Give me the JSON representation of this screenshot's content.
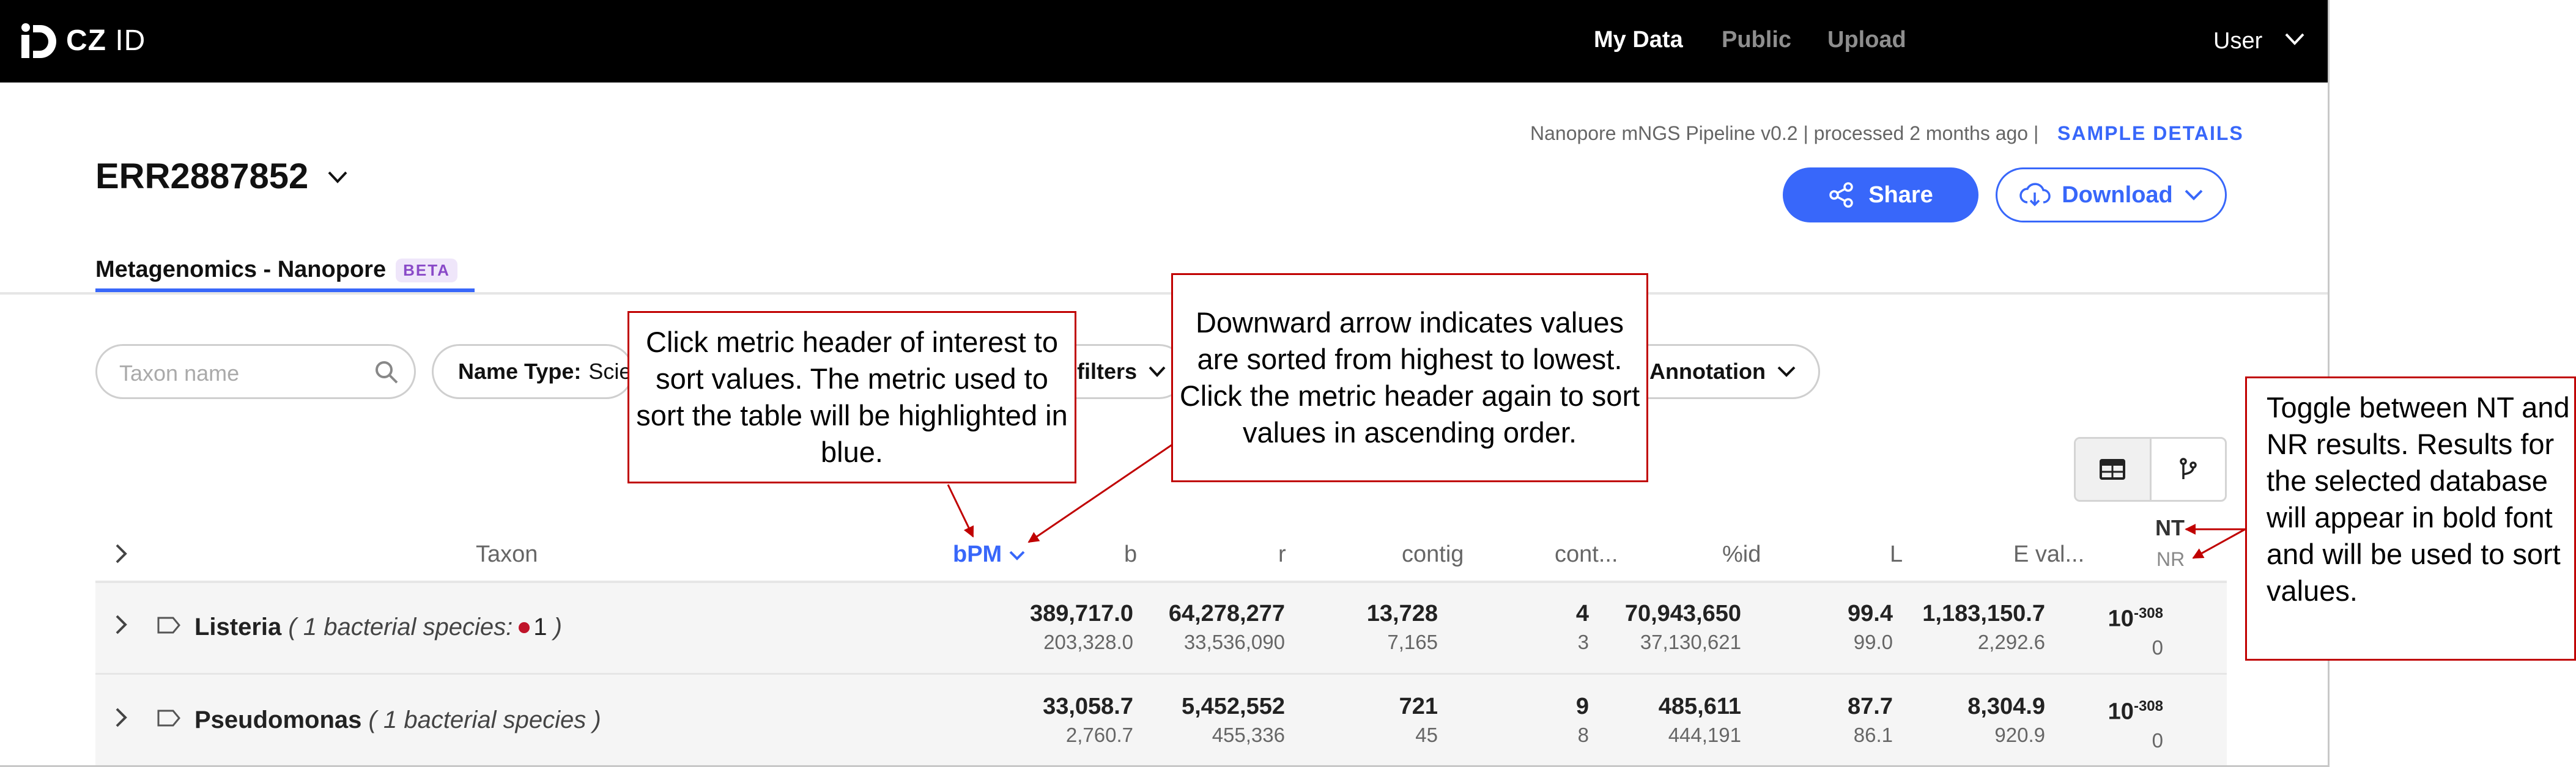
{
  "app": {
    "logo_text_bold": "CZ",
    "logo_text_light": "ID",
    "nav": {
      "my_data": "My Data",
      "public": "Public",
      "upload": "Upload",
      "user": "User"
    }
  },
  "header": {
    "pipeline_info": "Nanopore mNGS Pipeline v0.2 | processed 2 months ago |",
    "sample_details": "SAMPLE DETAILS",
    "sample_name": "ERR2887852",
    "share_label": "Share",
    "download_label": "Download",
    "tab_label": "Metagenomics - Nanopore",
    "tab_badge": "BETA"
  },
  "filters": {
    "search_placeholder": "Taxon name",
    "name_type_label": "Name Type:",
    "name_type_value": "Scie",
    "filters_label": "l filters",
    "annotation_label": "Annotation"
  },
  "table": {
    "columns": {
      "taxon": "Taxon",
      "bpm": "bPM",
      "b": "b",
      "r": "r",
      "contig": "contig",
      "cont": "cont...",
      "pid": "%id",
      "l": "L",
      "evalue": "E val...",
      "nt": "NT",
      "nr": "NR"
    },
    "rows": [
      {
        "name": "Listeria",
        "desc_open": "( ",
        "desc": "1 bacterial species:",
        "count": "1",
        "desc_close": ")",
        "bpm": {
          "nt": "389,717.0",
          "nr": "203,328.0"
        },
        "b": {
          "nt": "64,278,277",
          "nr": "33,536,090"
        },
        "r": {
          "nt": "13,728",
          "nr": "7,165"
        },
        "contig": {
          "nt": "4",
          "nr": "3"
        },
        "cont": {
          "nt": "70,943,650",
          "nr": "37,130,621"
        },
        "pid": {
          "nt": "99.4",
          "nr": "99.0"
        },
        "l": {
          "nt": "1,183,150.7",
          "nr": "2,292.6"
        },
        "evalue": {
          "nt_base": "10",
          "nt_exp": "-308",
          "nr": "0"
        }
      },
      {
        "name": "Pseudomonas",
        "desc_open": "( ",
        "desc": "1 bacterial species",
        "desc_close": " )",
        "bpm": {
          "nt": "33,058.7",
          "nr": "2,760.7"
        },
        "b": {
          "nt": "5,452,552",
          "nr": "455,336"
        },
        "r": {
          "nt": "721",
          "nr": "45"
        },
        "contig": {
          "nt": "9",
          "nr": "8"
        },
        "cont": {
          "nt": "485,611",
          "nr": "444,191"
        },
        "pid": {
          "nt": "87.7",
          "nr": "86.1"
        },
        "l": {
          "nt": "8,304.9",
          "nr": "920.9"
        },
        "evalue": {
          "nt_base": "10",
          "nt_exp": "-308",
          "nr": "0"
        }
      }
    ]
  },
  "callouts": {
    "sort_header": "Click metric header of interest to sort values. The metric used to sort the table will be highlighted in blue.",
    "sort_arrow": "Downward arrow indicates values are sorted from highest to lowest. Click the metric header again to sort values in ascending order.",
    "nt_nr_toggle": "Toggle between NT and NR results. Results for the selected database will appear in bold font and will be used to sort values."
  },
  "colors": {
    "accent": "#3867fa",
    "callout_border": "#c00000",
    "nav_bg": "#000000"
  }
}
